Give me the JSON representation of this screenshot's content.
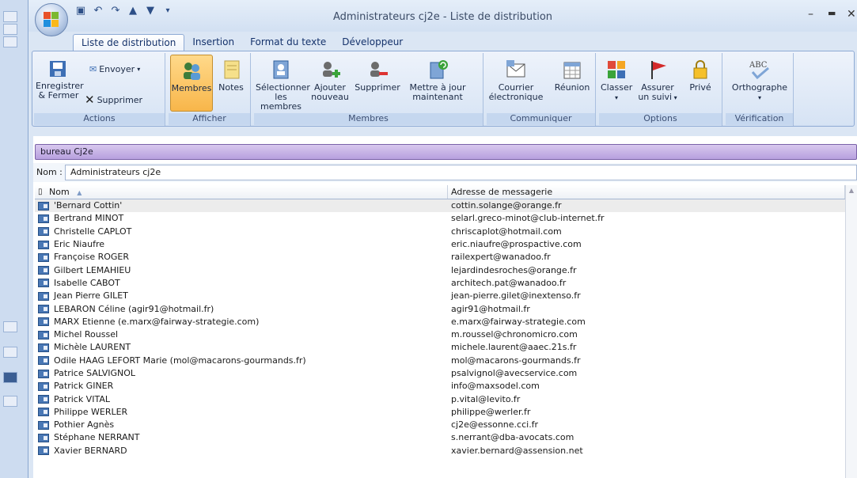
{
  "window": {
    "title": "Administrateurs cj2e - Liste de distribution"
  },
  "tabs": [
    "Liste de distribution",
    "Insertion",
    "Format du texte",
    "Développeur"
  ],
  "ribbon": {
    "actions": {
      "save_close": "Enregistrer & Fermer",
      "send": "Envoyer",
      "delete": "Supprimer",
      "group": "Actions"
    },
    "afficher": {
      "members": "Membres",
      "notes": "Notes",
      "group": "Afficher"
    },
    "membres": {
      "select": "Sélectionner les membres",
      "add": "Ajouter nouveau",
      "remove": "Supprimer",
      "update": "Mettre à jour maintenant",
      "group": "Membres"
    },
    "communiquer": {
      "email": "Courrier électronique",
      "meeting": "Réunion",
      "group": "Communiquer"
    },
    "options": {
      "categorize": "Classer",
      "followup": "Assurer un suivi",
      "private": "Privé",
      "group": "Options"
    },
    "verification": {
      "spelling": "Orthographe",
      "group": "Vérification"
    }
  },
  "groupbar": "bureau Cj2e",
  "name_label": "Nom :",
  "name_value": "Administrateurs cj2e",
  "columns": {
    "name": "Nom",
    "email": "Adresse de messagerie"
  },
  "members": [
    {
      "name": "'Bernard Cottin'",
      "email": "cottin.solange@orange.fr"
    },
    {
      "name": "Bertrand MINOT",
      "email": "selarl.greco-minot@club-internet.fr"
    },
    {
      "name": "Christelle CAPLOT",
      "email": "chriscaplot@hotmail.com"
    },
    {
      "name": "Eric Niaufre",
      "email": "eric.niaufre@prospactive.com"
    },
    {
      "name": "Françoise ROGER",
      "email": "railexpert@wanadoo.fr"
    },
    {
      "name": "Gilbert LEMAHIEU",
      "email": "lejardindesroches@orange.fr"
    },
    {
      "name": "Isabelle CABOT",
      "email": "architech.pat@wanadoo.fr"
    },
    {
      "name": "Jean Pierre GILET",
      "email": "jean-pierre.gilet@inextenso.fr"
    },
    {
      "name": "LEBARON Céline (agir91@hotmail.fr)",
      "email": "agir91@hotmail.fr"
    },
    {
      "name": "MARX Etienne (e.marx@fairway-strategie.com)",
      "email": "e.marx@fairway-strategie.com"
    },
    {
      "name": "Michel Roussel",
      "email": "m.roussel@chronomicro.com"
    },
    {
      "name": "Michèle LAURENT",
      "email": "michele.laurent@aaec.21s.fr"
    },
    {
      "name": "Odile HAAG LEFORT Marie (mol@macarons-gourmands.fr)",
      "email": "mol@macarons-gourmands.fr"
    },
    {
      "name": "Patrice SALVIGNOL",
      "email": "psalvignol@avecservice.com"
    },
    {
      "name": "Patrick GINER",
      "email": "info@maxsodel.com"
    },
    {
      "name": "Patrick VITAL",
      "email": "p.vital@levito.fr"
    },
    {
      "name": "Philippe WERLER",
      "email": "philippe@werler.fr"
    },
    {
      "name": "Pothier Agnès",
      "email": "cj2e@essonne.cci.fr"
    },
    {
      "name": "Stéphane NERRANT",
      "email": "s.nerrant@dba-avocats.com"
    },
    {
      "name": "Xavier BERNARD",
      "email": "xavier.bernard@assension.net"
    }
  ]
}
